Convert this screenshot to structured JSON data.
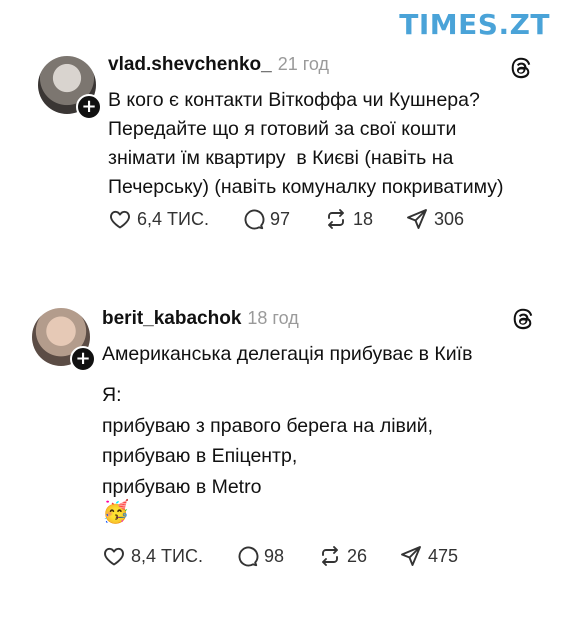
{
  "watermark": "TIMES.ZT",
  "posts": [
    {
      "username": "vlad.shevchenko_",
      "time": "21 год",
      "text": "В кого є контакти Віткоффа чи Кушнера?\nПередайте що я готовий за свої кошти\nзнімати їм квартиру  в Києві (навіть на\nПечерську) (навіть комуналку покриватиму)",
      "likes": "6,4 ТИС.",
      "comments": "97",
      "reposts": "18",
      "shares": "306"
    },
    {
      "username": "berit_kabachok",
      "time": "18 год",
      "text1": "Американська делегація прибуває в Київ",
      "text2": "Я:\nприбуваю з правого берега на лівий,\nприбуваю в Епіцентр,\nприбуваю в Metro",
      "emoji": "🥳",
      "likes": "8,4 ТИС.",
      "comments": "98",
      "reposts": "26",
      "shares": "475"
    }
  ],
  "icons": [
    "threads-icon",
    "heart-icon",
    "comment-icon",
    "repost-icon",
    "share-icon",
    "plus-icon"
  ],
  "colors": {
    "watermark": "#4aa3d8",
    "time": "#9a9a9a",
    "text": "#111111"
  }
}
